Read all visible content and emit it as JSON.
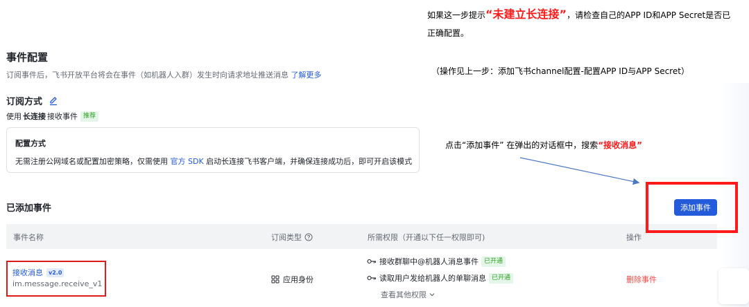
{
  "section": {
    "title": "事件配置",
    "desc": "订阅事件后，飞书开放平台将会在事件（如机器人入群）发生时向请求地址推送消息",
    "learn_more": "了解更多"
  },
  "subscription": {
    "title": "订阅方式",
    "use_prefix": "使用",
    "mode": "长连接",
    "mode_suffix": "接收事件",
    "recommend_tag": "推荐"
  },
  "config_box": {
    "title": "配置方式",
    "text_before": "无需注册公网域名或配置加密策略，仅需使用",
    "sdk_link": "官方 SDK",
    "text_after": "启动长连接飞书客户端，并确保连接成功后，即可开启该模式"
  },
  "added_events": {
    "title": "已添加事件",
    "add_button": "添加事件"
  },
  "table": {
    "headers": {
      "name": "事件名称",
      "type": "订阅类型",
      "perms": "所需权限（开通以下任一权限即可)",
      "action": "操作"
    },
    "rows": [
      {
        "name": "接收消息",
        "version": "v2.0",
        "code": "im.message.receive_v1",
        "type": "应用身份",
        "perms": [
          {
            "label": "接收群聊中@机器人消息事件",
            "status": "已开通"
          },
          {
            "label": "读取用户发给机器人的单聊消息",
            "status": "已开通"
          }
        ],
        "more_perms": "查看其他权限",
        "delete": "删除事件"
      }
    ]
  },
  "annotations": {
    "note1_prefix": "如果这一步提示",
    "note1_highlight": "“未建立长连接”",
    "note1_suffix": "，请检查自己的APP ID和APP Secret是否已正确配置。",
    "note2": "（操作见上一步：添加飞书channel配置-配置APP ID与APP Secret）",
    "note3_prefix": "点击“添加事件” 在弹出的对话框中，搜索",
    "note3_highlight": "“接收消息”"
  },
  "colors": {
    "primary": "#245bdb",
    "danger": "#f54a45",
    "annotation_red": "#ff1a1a",
    "success": "#2ea121"
  }
}
